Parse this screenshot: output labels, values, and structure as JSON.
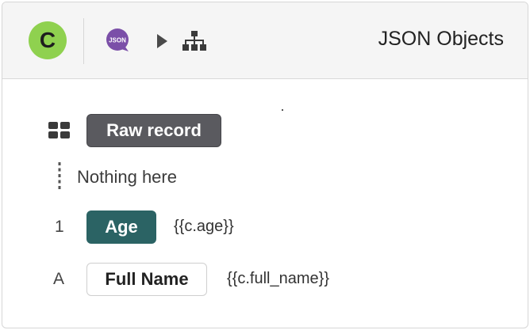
{
  "header": {
    "avatar_letter": "C",
    "app_badge_text": "JSON",
    "title": "JSON Objects",
    "icons": [
      "json-app-icon",
      "play-icon",
      "hierarchy-icon"
    ],
    "colors": {
      "avatar": "#8fd14f",
      "badge": "#7b4fa8"
    }
  },
  "fields": [
    {
      "type_icon": "grid-icon",
      "label": "Raw record",
      "style": "dark"
    },
    {
      "type_icon": "vertical-dots-icon",
      "label": "Nothing here",
      "style": "plain"
    },
    {
      "type_marker": "1",
      "label": "Age",
      "expression": "{{c.age}}",
      "style": "teal"
    },
    {
      "type_marker": "A",
      "label": "Full Name",
      "expression": "{{c.full_name}}",
      "style": "outline"
    }
  ],
  "colors": {
    "dark_pill": "#5a5a5f",
    "teal_pill": "#2b6364"
  }
}
